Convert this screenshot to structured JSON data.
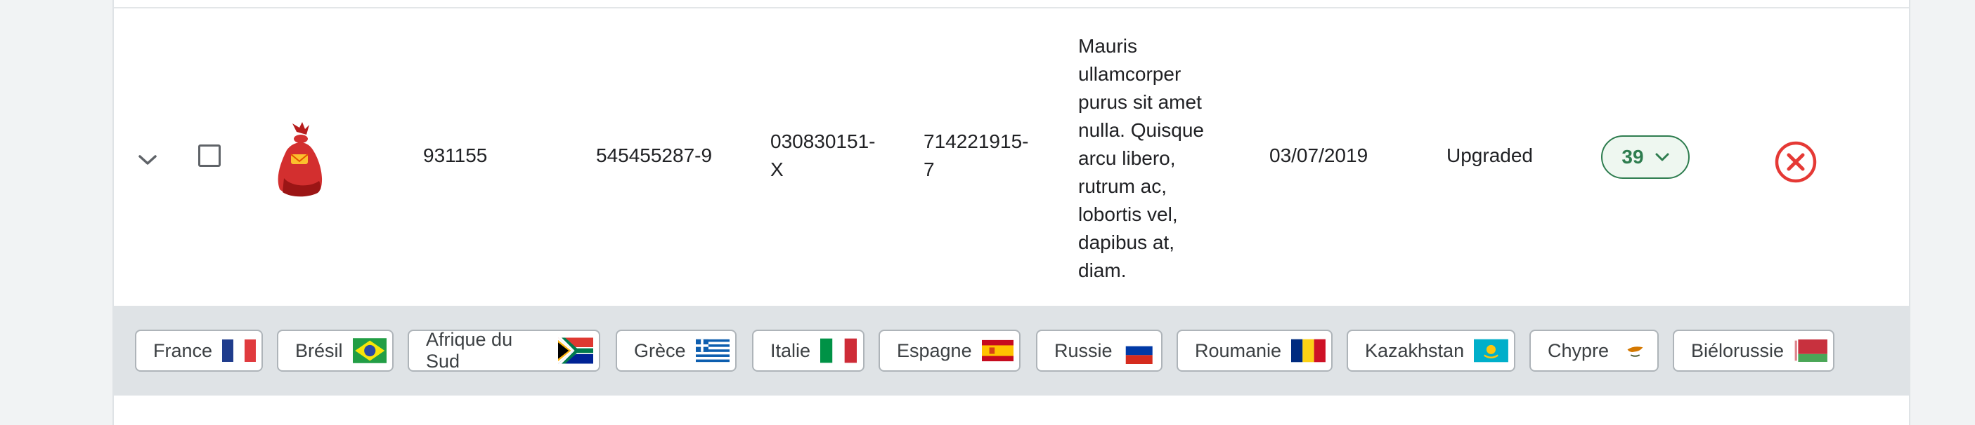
{
  "row": {
    "expand_icon": "chevron-down-icon",
    "col_id": "931155",
    "col_code_a": "545455287-9",
    "col_code_b_line1": "030830151-",
    "col_code_b_line2": "X",
    "col_code_c_line1": "714221915-",
    "col_code_c_line2": "7",
    "description_lines": [
      "Mauris",
      "ullamcorper",
      "purus sit amet",
      "nulla. Quisque",
      "arcu libero,",
      "rutrum ac,",
      "lobortis vel,",
      "dapibus at,",
      "diam."
    ],
    "date": "03/07/2019",
    "status": "Upgraded",
    "count": "39",
    "count_icon": "chevron-down-icon",
    "remove_icon": "close-circle-icon"
  },
  "colors": {
    "accent_green": "#2e7d4f",
    "danger_red": "#e53935",
    "tagbar_bg": "#dfe3e6"
  },
  "countries": [
    {
      "label": "France",
      "flag": "france-flag"
    },
    {
      "label": "Brésil",
      "flag": "brazil-flag"
    },
    {
      "label": "Afrique du Sud",
      "flag": "south-africa-flag"
    },
    {
      "label": "Grèce",
      "flag": "greece-flag"
    },
    {
      "label": "Italie",
      "flag": "italy-flag"
    },
    {
      "label": "Espagne",
      "flag": "spain-flag"
    },
    {
      "label": "Russie",
      "flag": "russia-flag"
    },
    {
      "label": "Roumanie",
      "flag": "romania-flag"
    },
    {
      "label": "Kazakhstan",
      "flag": "kazakhstan-flag"
    },
    {
      "label": "Chypre",
      "flag": "cyprus-flag"
    },
    {
      "label": "Biélorussie",
      "flag": "belarus-flag"
    }
  ]
}
